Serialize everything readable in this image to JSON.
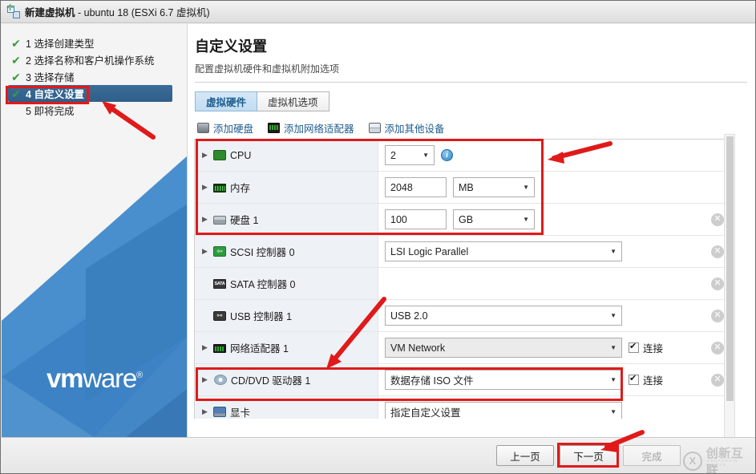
{
  "window": {
    "title_bold": "新建虚拟机",
    "title_rest": " - ubuntu 18 (ESXi 6.7 虚拟机)",
    "icon": "new-vm-icon"
  },
  "sidebar": {
    "brand": {
      "bold": "vm",
      "regular": "ware",
      "tm": "®"
    },
    "steps": [
      {
        "num": "1",
        "label": "选择创建类型",
        "state": "done",
        "check": "✔"
      },
      {
        "num": "2",
        "label": "选择名称和客户机操作系统",
        "state": "done",
        "check": "✔"
      },
      {
        "num": "3",
        "label": "选择存储",
        "state": "done",
        "check": "✔"
      },
      {
        "num": "4",
        "label": "自定义设置",
        "state": "active",
        "check": "✔"
      },
      {
        "num": "5",
        "label": "即将完成",
        "state": "pending",
        "check": ""
      }
    ]
  },
  "header": {
    "title": "自定义设置",
    "subtitle": "配置虚拟机硬件和虚拟机附加选项"
  },
  "tabs": [
    {
      "label": "虚拟硬件",
      "active": true
    },
    {
      "label": "虚拟机选项",
      "active": false
    }
  ],
  "toolbar": [
    {
      "label": "添加硬盘",
      "icon": "hard-disk-icon"
    },
    {
      "label": "添加网络适配器",
      "icon": "network-adapter-icon"
    },
    {
      "label": "添加其他设备",
      "icon": "other-device-icon"
    }
  ],
  "devices": [
    {
      "name": "CPU",
      "icon": "cpu-icon",
      "expandable": true,
      "control": "select",
      "value": "2",
      "info_icon": "info-icon",
      "removable": false
    },
    {
      "name": "内存",
      "icon": "memory-icon",
      "expandable": true,
      "control": "text-unit",
      "value": "2048",
      "unit": "MB",
      "removable": false
    },
    {
      "name": "硬盘 1",
      "icon": "hard-disk-icon",
      "expandable": true,
      "control": "text-unit",
      "value": "100",
      "unit": "GB",
      "removable": true
    },
    {
      "name": "SCSI 控制器 0",
      "icon": "scsi-controller-icon",
      "expandable": true,
      "control": "select-wide",
      "value": "LSI Logic Parallel",
      "removable": true
    },
    {
      "name": "SATA 控制器 0",
      "icon": "sata-controller-icon",
      "expandable": false,
      "control": "none",
      "value": "",
      "removable": true
    },
    {
      "name": "USB 控制器 1",
      "icon": "usb-controller-icon",
      "expandable": false,
      "control": "select-wide",
      "value": "USB 2.0",
      "removable": true
    },
    {
      "name": "网络适配器 1",
      "icon": "network-adapter-icon",
      "expandable": true,
      "control": "select-wide-gray",
      "value": "VM Network",
      "connect_label": "连接",
      "connected": true,
      "removable": true
    },
    {
      "name": "CD/DVD 驱动器 1",
      "icon": "cd-dvd-icon",
      "expandable": true,
      "control": "select-wide",
      "value": "数据存储 ISO 文件",
      "connect_label": "连接",
      "connected": true,
      "removable": true
    },
    {
      "name": "显卡",
      "icon": "video-card-icon",
      "expandable": true,
      "control": "select-wide",
      "value": "指定自定义设置",
      "removable": false
    }
  ],
  "footer": {
    "prev": "上一页",
    "next": "下一页",
    "finish": "完成"
  },
  "watermark": {
    "mark": "X",
    "text": "创新互联",
    "sub": "CHUANGXIN HULIAN"
  },
  "colors": {
    "accent_blue": "#3c82c4",
    "annotation_red": "#e01a1a",
    "active_step_blue": "#2f5f89",
    "check_green": "#3a9a3a"
  },
  "annotations": {
    "boxes": [
      {
        "name": "step-4-highlight"
      },
      {
        "name": "cpu-memory-disk-highlight"
      },
      {
        "name": "cd-dvd-highlight"
      },
      {
        "name": "next-button-highlight"
      }
    ],
    "arrows": [
      {
        "name": "arrow-to-step-4"
      },
      {
        "name": "arrow-to-hardware-box"
      },
      {
        "name": "arrow-to-cd-dvd"
      },
      {
        "name": "arrow-to-next-button"
      }
    ]
  }
}
